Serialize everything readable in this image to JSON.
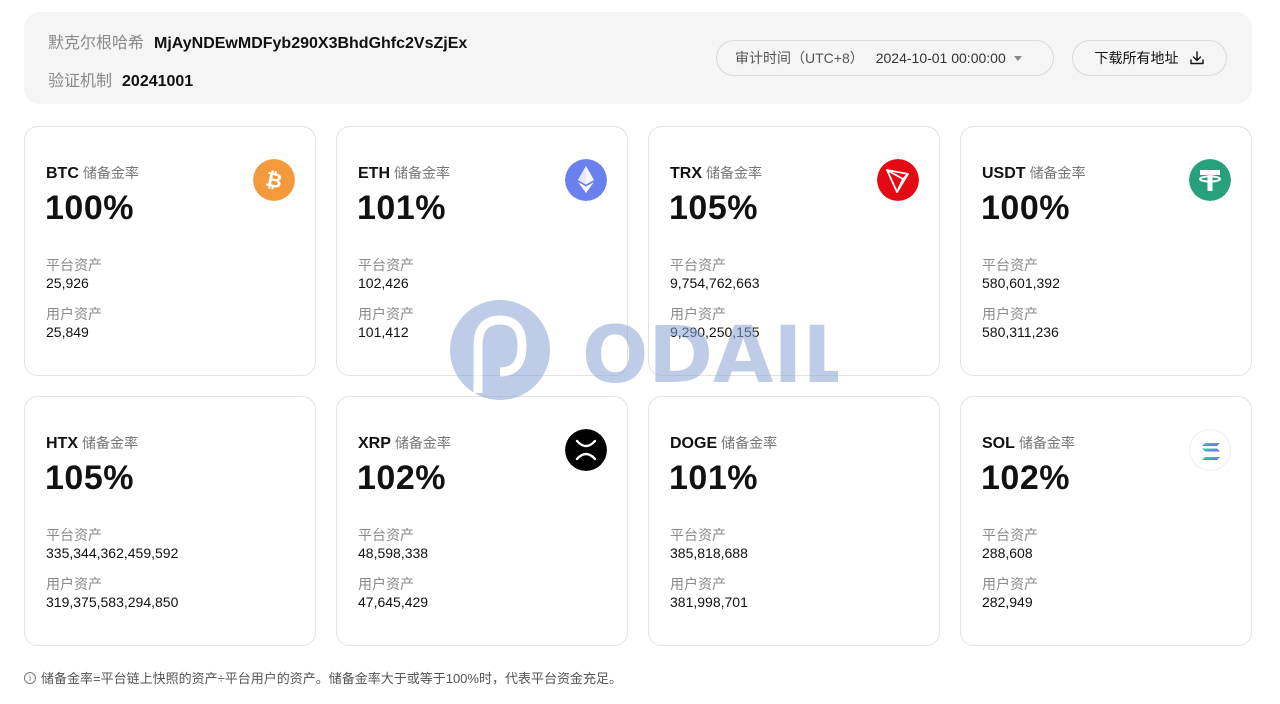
{
  "header": {
    "merkle_label": "默克尔根哈希",
    "merkle_value": "MjAyNDEwMDFyb290X3BhdGhfc2VsZjEx",
    "mechanism_label": "验证机制",
    "mechanism_value": "20241001",
    "audit_time_label": "审计时间（UTC+8）",
    "audit_time_value": "2024-10-01 00:00:00",
    "download_label": "下载所有地址"
  },
  "labels": {
    "ratio": "储备金率",
    "platform_assets": "平台资产",
    "user_assets": "用户资产"
  },
  "cards": [
    {
      "symbol": "BTC",
      "ratio": "100%",
      "platform": "25,926",
      "user": "25,849",
      "icon": "bitcoin-icon",
      "color": "#f39a3d"
    },
    {
      "symbol": "ETH",
      "ratio": "101%",
      "platform": "102,426",
      "user": "101,412",
      "icon": "ethereum-icon",
      "color": "#6a80ee"
    },
    {
      "symbol": "TRX",
      "ratio": "105%",
      "platform": "9,754,762,663",
      "user": "9,290,250,155",
      "icon": "tron-icon",
      "color": "#e50914"
    },
    {
      "symbol": "USDT",
      "ratio": "100%",
      "platform": "580,601,392",
      "user": "580,311,236",
      "icon": "tether-icon",
      "color": "#26a17b"
    },
    {
      "symbol": "HTX",
      "ratio": "105%",
      "platform": "335,344,362,459,592",
      "user": "319,375,583,294,850",
      "icon": "",
      "color": ""
    },
    {
      "symbol": "XRP",
      "ratio": "102%",
      "platform": "48,598,338",
      "user": "47,645,429",
      "icon": "xrp-icon",
      "color": "#000000"
    },
    {
      "symbol": "DOGE",
      "ratio": "101%",
      "platform": "385,818,688",
      "user": "381,998,701",
      "icon": "",
      "color": ""
    },
    {
      "symbol": "SOL",
      "ratio": "102%",
      "platform": "288,608",
      "user": "282,949",
      "icon": "solana-icon",
      "color": "#9945ff"
    }
  ],
  "watermark": "ODAILY",
  "footnote": "储备金率=平台链上快照的资产÷平台用户的资产。储备金率大于或等于100%时，代表平台资金充足。"
}
